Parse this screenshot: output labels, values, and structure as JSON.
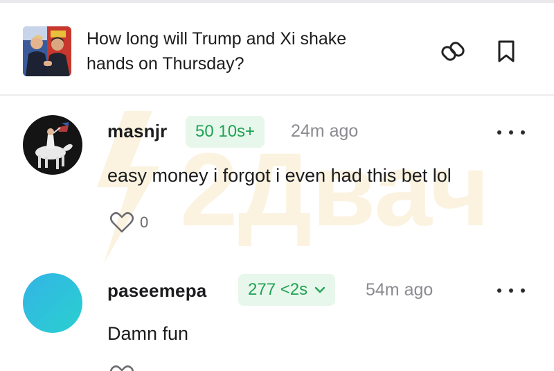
{
  "market": {
    "title": "How long will Trump and Xi shake hands on Thursday?",
    "thumbnail_icon": "handshake-photo-icon",
    "link_icon": "link-icon",
    "bookmark_icon": "bookmark-icon"
  },
  "watermark": {
    "brand": "2Двач"
  },
  "comments": [
    {
      "username": "masnjr",
      "position": "50 10s+",
      "time": "24m ago",
      "text": "easy money i forgot i even had this bet lol",
      "likes": "0",
      "avatar_icon": "rider-on-horse-avatar"
    },
    {
      "username": "paseemepa",
      "position": "277 <2s",
      "time": "54m ago",
      "text": "Damn fun",
      "avatar_icon": "blue-gradient-avatar"
    }
  ],
  "colors": {
    "badge_bg": "#e8f7ec",
    "badge_text": "#1fa352",
    "muted": "#8a8a90",
    "watermark": "#fbf3e0"
  }
}
